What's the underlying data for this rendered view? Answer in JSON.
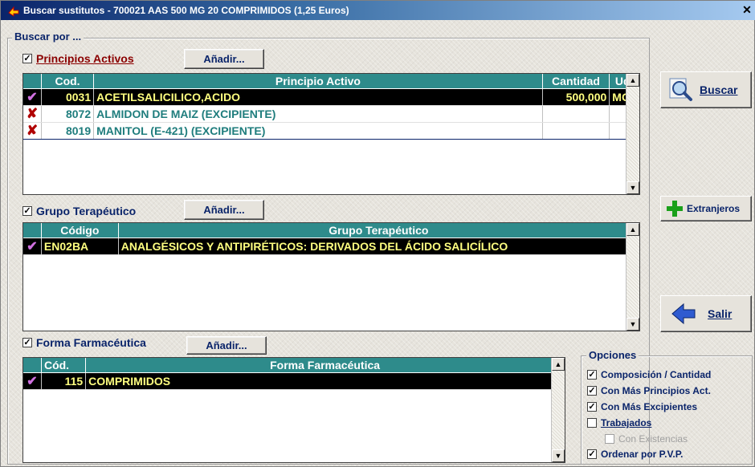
{
  "window": {
    "title": "Buscar sustitutos - 700021 AAS 500 MG 20 COMPRIMIDOS (1,25 Euros)",
    "close_glyph": "✕"
  },
  "buscar_por": {
    "legend": "Buscar por ..."
  },
  "principios": {
    "checked": true,
    "label": "Principios Activos",
    "add_button": "Añadir...",
    "columns": [
      "",
      "Cod.",
      "Principio Activo",
      "Cantidad",
      "Ud."
    ],
    "rows": [
      {
        "status": "check",
        "cod": "0031",
        "principio": "ACETILSALICILICO,ACIDO",
        "cantidad": "500,000",
        "ud": "MG",
        "selected": true
      },
      {
        "status": "cross",
        "cod": "8072",
        "principio": "ALMIDON DE MAIZ (EXCIPIENTE)",
        "cantidad": "",
        "ud": "",
        "selected": false
      },
      {
        "status": "cross",
        "cod": "8019",
        "principio": "MANITOL (E-421) (EXCIPIENTE)",
        "cantidad": "",
        "ud": "",
        "selected": false
      }
    ]
  },
  "grupo": {
    "checked": true,
    "label": "Grupo Terapéutico",
    "add_button": "Añadir...",
    "columns": [
      "",
      "Código",
      "Grupo Terapéutico"
    ],
    "rows": [
      {
        "status": "check",
        "codigo": "EN02BA",
        "grupo": "ANALGÉSICOS Y ANTIPIRÉTICOS: DERIVADOS DEL ÁCIDO SALICÍLICO",
        "selected": true
      }
    ]
  },
  "forma": {
    "checked": true,
    "label": "Forma Farmacéutica",
    "add_button": "Añadir...",
    "columns": [
      "",
      "Cód.",
      "Forma Farmacéutica"
    ],
    "rows": [
      {
        "status": "check",
        "cod": "115",
        "forma": "COMPRIMIDOS",
        "selected": true
      }
    ]
  },
  "buttons": {
    "buscar": "Buscar",
    "extranjeros": "Extranjeros",
    "salir": "Salir"
  },
  "opciones": {
    "legend": "Opciones",
    "items": [
      {
        "label": "Composición / Cantidad",
        "checked": true,
        "enabled": true
      },
      {
        "label": "Con Más Principios Act.",
        "checked": true,
        "enabled": true
      },
      {
        "label": "Con Más Excipientes",
        "checked": true,
        "enabled": true
      },
      {
        "label": "Trabajados",
        "checked": false,
        "enabled": true
      },
      {
        "label": "Con Existencias",
        "checked": false,
        "enabled": false
      },
      {
        "label": "Ordenar por P.V.P.",
        "checked": true,
        "enabled": true
      }
    ]
  },
  "glyphs": {
    "check_mark": "✔",
    "cross_mark": "✘",
    "box_check": "✓",
    "arrow_up": "▲",
    "arrow_down": "▼"
  },
  "colors": {
    "header_teal": "#2e8b8b",
    "selected_text": "#ffff80",
    "row_text": "#1f7d7d",
    "accent_navy": "#0a246a"
  }
}
